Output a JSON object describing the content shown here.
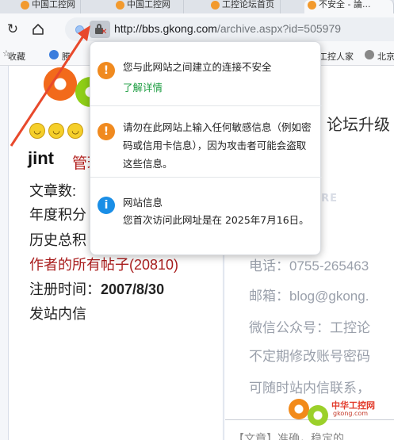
{
  "tabs": [
    {
      "label": "中国工控网"
    },
    {
      "label": "中国工控网"
    },
    {
      "label": "工控论坛首页"
    },
    {
      "label": "不安全 - 論..."
    }
  ],
  "toolbar": {
    "url_host": "http://bbs.gkong.com",
    "url_path": "/archive.aspx?id=505979"
  },
  "bookmarks": {
    "items": [
      {
        "label": "收藏"
      },
      {
        "label": "腾"
      },
      {
        "label": "工控人家"
      },
      {
        "label": "北京"
      }
    ]
  },
  "security_popup": {
    "connection_warning": "您与此网站之间建立的连接不安全",
    "learn_more": "了解详情",
    "sensitive_warning": "请勿在此网站上输入任何敏感信息（例如密码或信用卡信息），因为攻击者可能会盗取这些信息。",
    "site_info_title": "网站信息",
    "site_info_detail": "您首次访问此网址是在 2025年7月16日。"
  },
  "user": {
    "name": "jint",
    "role": "管理",
    "articles_label": "文章数:",
    "yearly_points_label": "年度积分",
    "history_total_label": "历史总积",
    "all_posts": "作者的所有帖子",
    "all_posts_count": "(20810)",
    "register_label": "注册时间：",
    "register_date": "2007/8/30",
    "message_link": "发站内信"
  },
  "right_panel": {
    "title": "论坛升级",
    "watermark": "KRE",
    "phone": "电话：0755-265463",
    "email": "邮箱：blog@gkong.",
    "wechat": "微信公众号：工控论",
    "notice1": "不定期修改账号密码",
    "notice2": "可随时站内信联系，",
    "news": "【文章】准确，稳定的",
    "logo_text": "中华工控网",
    "logo_sub": "gkong.com"
  }
}
